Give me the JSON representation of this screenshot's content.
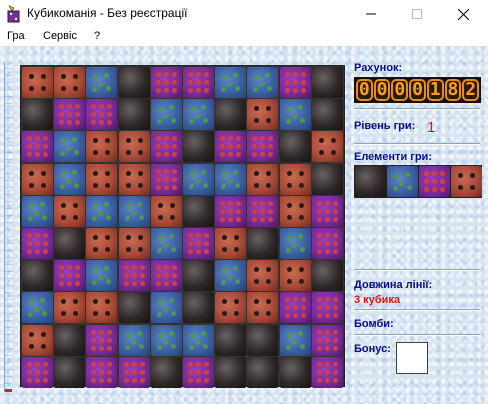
{
  "window": {
    "title": "Кубикоманія - Без реєстрації",
    "icon": "dice-app-icon",
    "controls": [
      "minimize-icon",
      "maximize-icon",
      "close-icon"
    ]
  },
  "menu": {
    "items": [
      {
        "label": "Гра"
      },
      {
        "label": "Сервіс"
      },
      {
        "label": "?"
      }
    ]
  },
  "panel": {
    "score_label": "Рахунок:",
    "score_digits": [
      "0",
      "0",
      "0",
      "0",
      "1",
      "8",
      "2"
    ],
    "level_label": "Рівень гри:",
    "level_value": "1",
    "elements_label": "Елементи гри:",
    "line_length_label": "Довжина лінії:",
    "line_length_value": "3 кубика",
    "bombs_label": "Бомби:",
    "bonus_label": "Бонус:"
  },
  "progress": {
    "value_fraction": 0.01
  },
  "colors": {
    "black_cube": "#2a2424",
    "blue_cube": "#3c5ea0",
    "purple_cube": "#7a2c9a",
    "brown_cube": "#a84a38",
    "label": "#0a0a8c",
    "value_red": "#e01010",
    "score_digit": "#f5a020"
  },
  "elements": [
    "black",
    "blue",
    "purple",
    "brown"
  ],
  "board": {
    "rows": 10,
    "cols": 10,
    "cells": [
      [
        "brown",
        "brown",
        "blue",
        "black",
        "purple",
        "purple",
        "blue",
        "blue",
        "purple",
        "black"
      ],
      [
        "black",
        "purple",
        "purple",
        "black",
        "blue",
        "blue",
        "black",
        "brown",
        "blue",
        "black"
      ],
      [
        "purple",
        "blue",
        "brown",
        "brown",
        "purple",
        "black",
        "purple",
        "purple",
        "black",
        "brown"
      ],
      [
        "brown",
        "blue",
        "brown",
        "brown",
        "purple",
        "blue",
        "blue",
        "brown",
        "brown",
        "black"
      ],
      [
        "blue",
        "brown",
        "blue",
        "blue",
        "brown",
        "black",
        "purple",
        "purple",
        "brown",
        "purple"
      ],
      [
        "purple",
        "black",
        "brown",
        "brown",
        "blue",
        "purple",
        "brown",
        "black",
        "blue",
        "purple"
      ],
      [
        "black",
        "purple",
        "blue",
        "purple",
        "purple",
        "black",
        "blue",
        "brown",
        "brown",
        "black"
      ],
      [
        "blue",
        "brown",
        "brown",
        "black",
        "blue",
        "black",
        "brown",
        "brown",
        "purple",
        "purple"
      ],
      [
        "brown",
        "black",
        "purple",
        "blue",
        "blue",
        "blue",
        "black",
        "black",
        "blue",
        "purple"
      ],
      [
        "purple",
        "black",
        "purple",
        "purple",
        "black",
        "purple",
        "black",
        "black",
        "black",
        "purple"
      ]
    ]
  }
}
